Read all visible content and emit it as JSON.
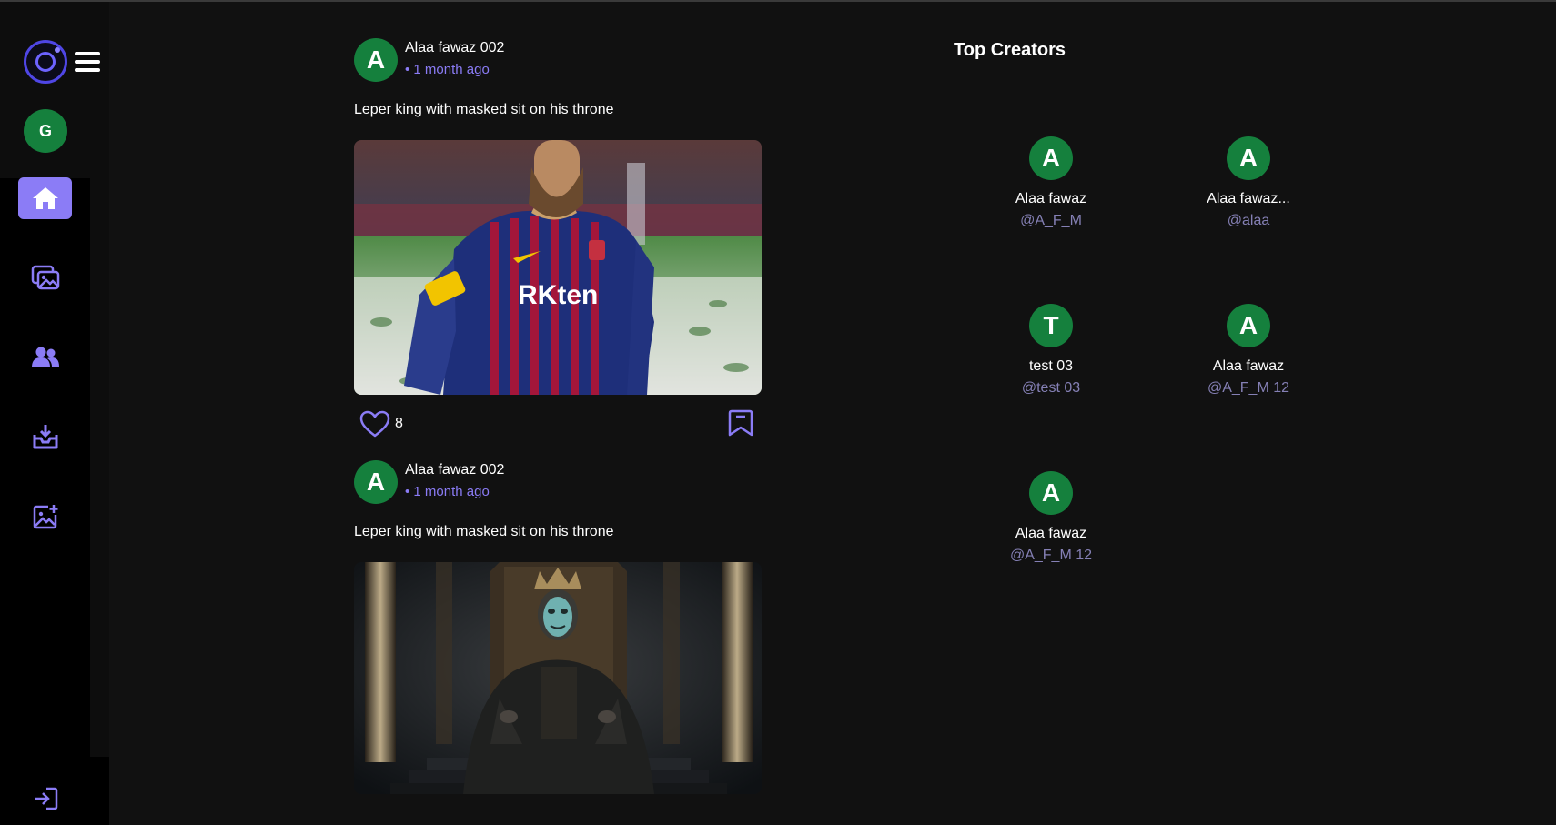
{
  "sidebar": {
    "user_initial": "G",
    "nav": [
      {
        "name": "home",
        "icon": "home-icon",
        "active": true
      },
      {
        "name": "gallery",
        "icon": "images-icon",
        "active": false
      },
      {
        "name": "people",
        "icon": "users-icon",
        "active": false
      },
      {
        "name": "saved",
        "icon": "save-tray-icon",
        "active": false
      },
      {
        "name": "create",
        "icon": "image-add-icon",
        "active": false
      }
    ],
    "logout_icon": "logout-icon"
  },
  "posts": [
    {
      "author_initial": "A",
      "author": "Alaa fawaz 002",
      "time": "• 1 month ago",
      "caption": "Leper king with masked sit on his throne",
      "image": "soccer-player-image",
      "likes": "8"
    },
    {
      "author_initial": "A",
      "author": "Alaa fawaz 002",
      "time": "• 1 month ago",
      "caption": "Leper king with masked sit on his throne",
      "image": "masked-king-throne-image"
    }
  ],
  "top_creators": {
    "title": "Top Creators",
    "items": [
      {
        "initial": "A",
        "name": "Alaa fawaz",
        "handle": "@A_F_M"
      },
      {
        "initial": "A",
        "name": "Alaa fawaz...",
        "handle": "@alaa"
      },
      {
        "initial": "T",
        "name": "test 03",
        "handle": "@test 03"
      },
      {
        "initial": "A",
        "name": "Alaa fawaz",
        "handle": "@A_F_M 12"
      },
      {
        "initial": "A",
        "name": "Alaa fawaz",
        "handle": "@A_F_M 12"
      }
    ]
  },
  "colors": {
    "background": "#111111",
    "sidebar": "#000000",
    "accent": "#8b7cf6",
    "avatar": "#15803d",
    "handle": "#8580b5"
  }
}
